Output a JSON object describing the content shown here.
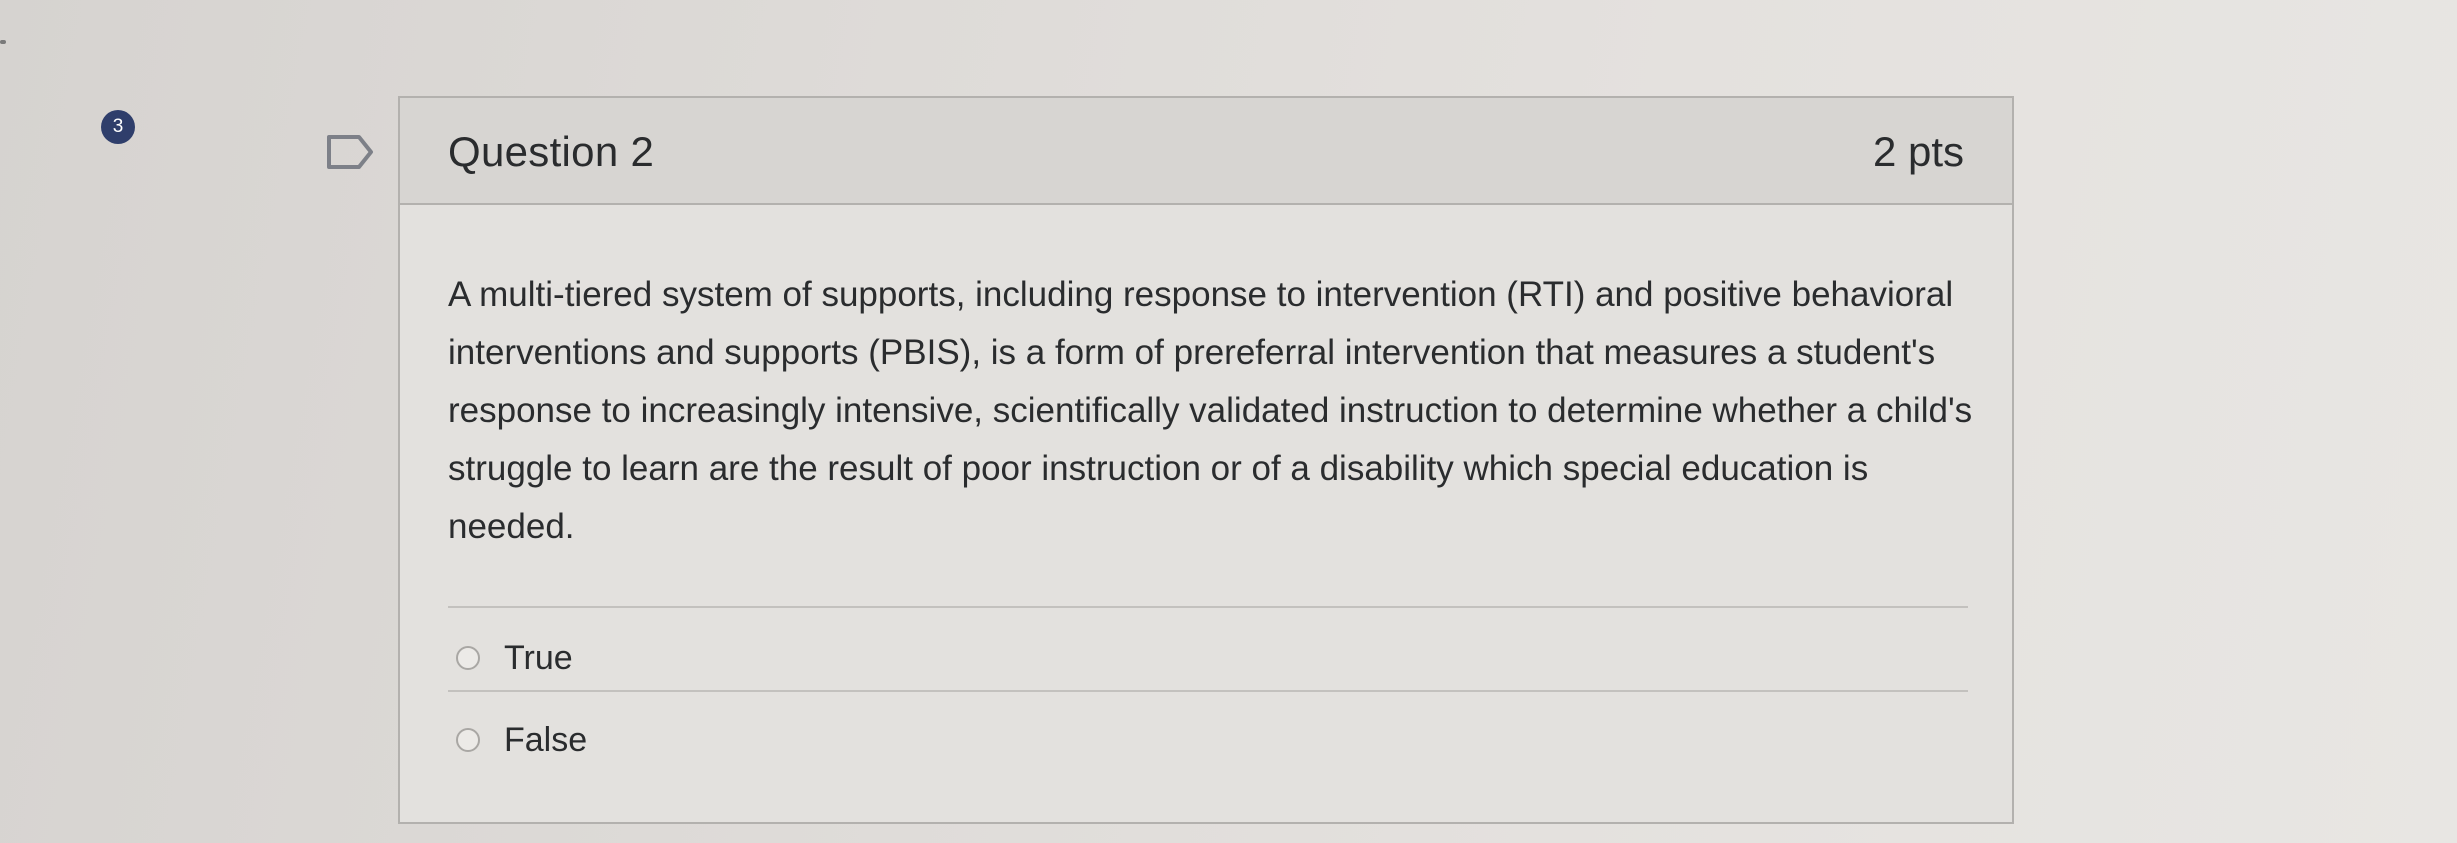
{
  "question_nav": {
    "number": "3"
  },
  "question": {
    "title": "Question 2",
    "points": "2 pts",
    "text": "A multi-tiered system of supports, including response to intervention (RTI) and positive behavioral interventions and supports (PBIS), is a form of prereferral intervention that measures a student's response to increasingly intensive, scientifically validated instruction to determine whether a child's struggle to learn are the result of poor instruction or of a disability which special education is needed.",
    "answers": [
      {
        "label": "True",
        "selected": false
      },
      {
        "label": "False",
        "selected": false
      }
    ]
  },
  "icons": {
    "flag": "flag-icon",
    "radio": "radio-button-icon"
  },
  "colors": {
    "badge": "#2f3e6b",
    "header_bg": "#d7d5d2",
    "card_bg": "#e3e1de"
  }
}
